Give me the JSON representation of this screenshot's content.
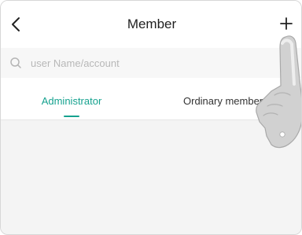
{
  "header": {
    "title": "Member",
    "back_icon": "chevron-left-icon",
    "add_icon": "plus-icon"
  },
  "search": {
    "placeholder": "user Name/account",
    "icon": "search-icon"
  },
  "tabs": [
    {
      "label": "Administrator",
      "active": true
    },
    {
      "label": "Ordinary member",
      "active": false
    }
  ],
  "accent_color": "#16a28f"
}
